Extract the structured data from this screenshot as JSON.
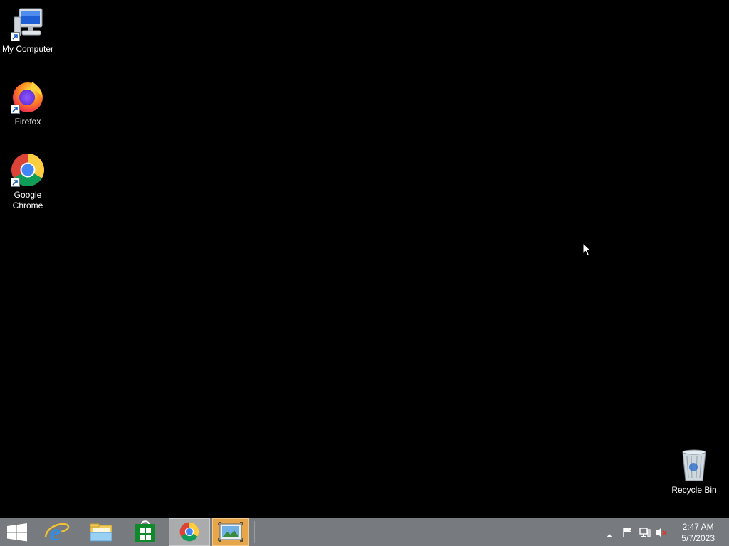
{
  "desktop": {
    "icons": [
      {
        "label": "My Computer",
        "icon": "computer-icon"
      },
      {
        "label": "Firefox",
        "icon": "firefox-icon"
      },
      {
        "label": "Google Chrome",
        "icon": "chrome-icon"
      },
      {
        "label": "Recycle Bin",
        "icon": "recycle-bin-icon"
      }
    ]
  },
  "taskbar": {
    "buttons": [
      {
        "icon": "windows-start-icon"
      },
      {
        "icon": "internet-explorer-icon"
      },
      {
        "icon": "file-explorer-icon"
      },
      {
        "icon": "store-icon"
      },
      {
        "icon": "chrome-icon",
        "active": true
      },
      {
        "icon": "image-viewer-icon",
        "active": true
      }
    ],
    "tray": {
      "icons": [
        "show-hidden-icons-icon",
        "action-center-flag-icon",
        "network-icon",
        "volume-muted-icon"
      ],
      "time": "2:47 AM",
      "date": "5/7/2023"
    }
  },
  "colors": {
    "desktop_background": "#000000",
    "taskbar": "#777a7e",
    "active_image_viewer": "#e8a64a"
  }
}
